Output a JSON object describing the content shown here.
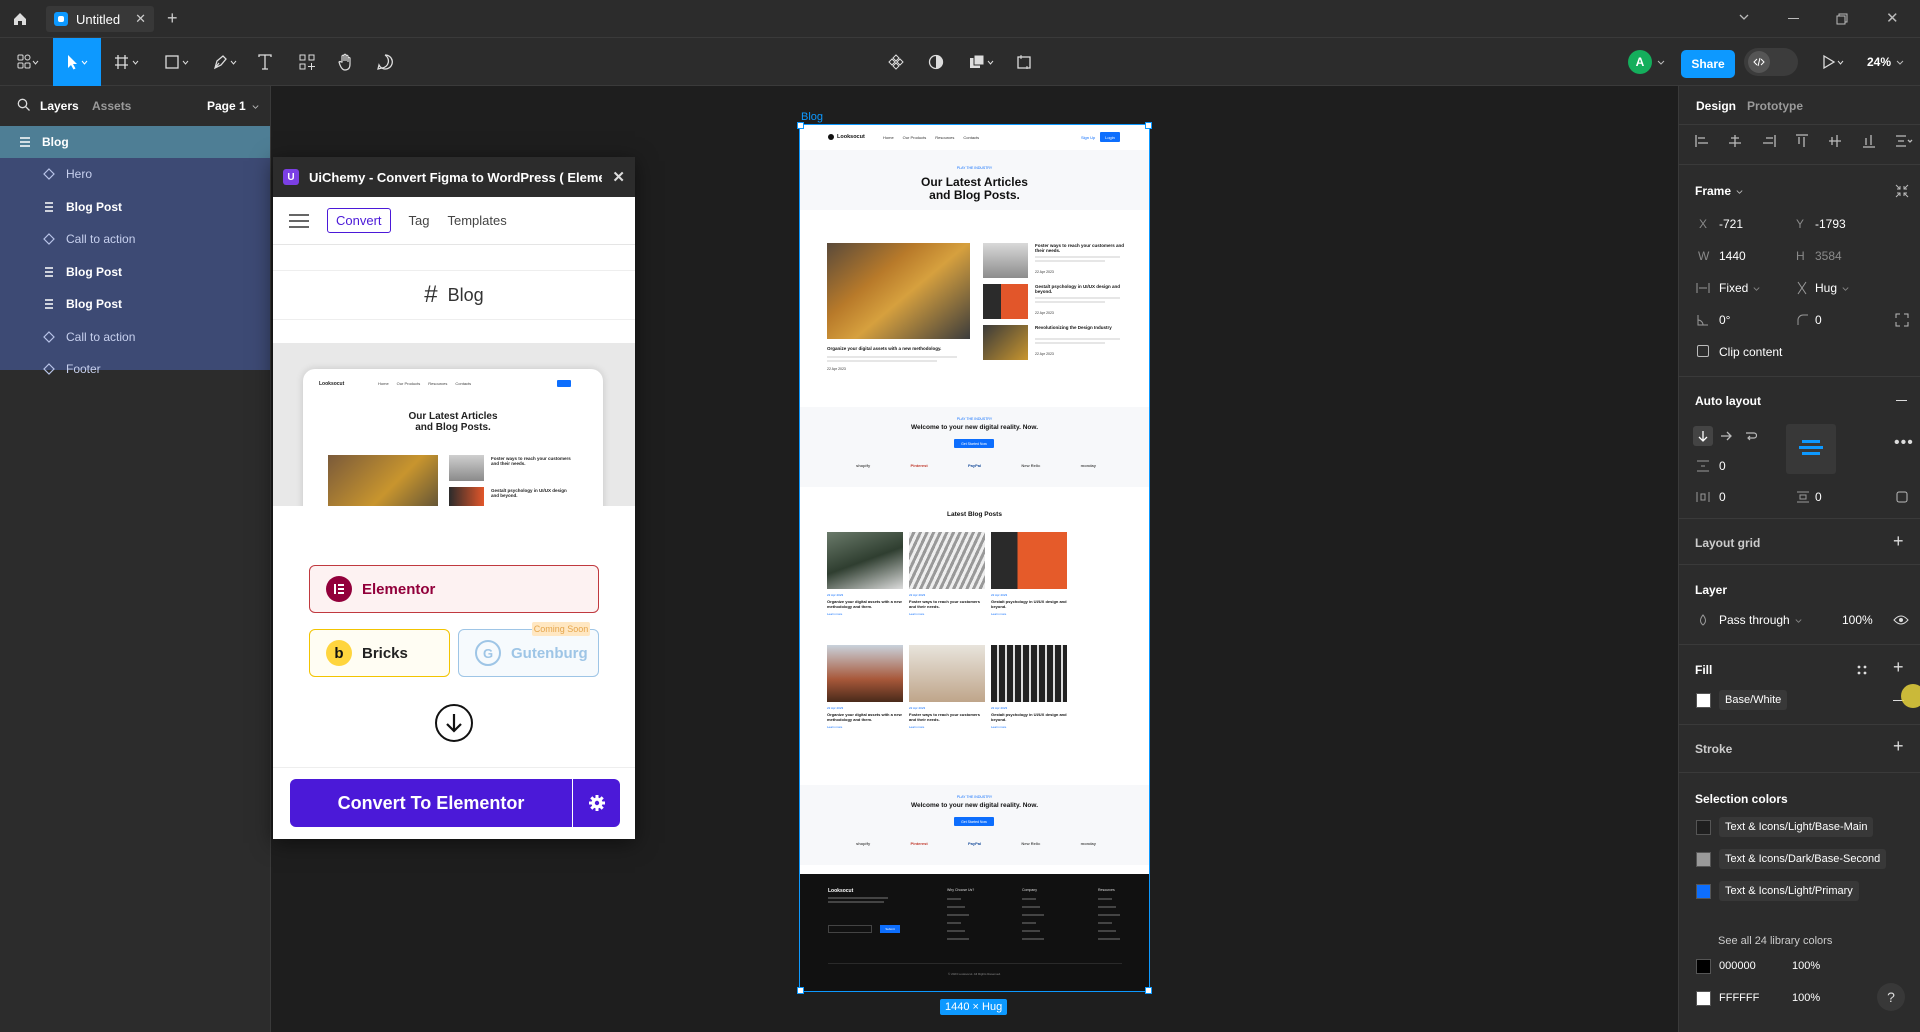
{
  "window": {
    "tab_title": "Untitled"
  },
  "toolbar": {
    "share_label": "Share",
    "zoom": "24%",
    "avatar_letter": "A"
  },
  "left_panel": {
    "tabs": [
      "Layers",
      "Assets"
    ],
    "page": "Page 1",
    "root_layer": "Blog",
    "layers": [
      {
        "name": "Hero",
        "kind": "component"
      },
      {
        "name": "Blog Post",
        "kind": "autolayout"
      },
      {
        "name": "Call to action",
        "kind": "component"
      },
      {
        "name": "Blog Post",
        "kind": "autolayout"
      },
      {
        "name": "Blog Post",
        "kind": "autolayout"
      },
      {
        "name": "Call to action",
        "kind": "component"
      },
      {
        "name": "Footer",
        "kind": "component"
      }
    ]
  },
  "plugin": {
    "title": "UiChemy - Convert Figma to WordPress ( Elemento...",
    "tabs": [
      "Convert",
      "Tag",
      "Templates"
    ],
    "frame_name": "Blog",
    "preview": {
      "logo": "Looksocut",
      "nav": [
        "Home",
        "Our Products",
        "Resources",
        "Contacts"
      ],
      "heading_l1": "Our Latest Articles",
      "heading_l2": "and Blog Posts.",
      "side1": "Foster ways to reach your customers and their needs.",
      "side2": "Gestalt psychology in UI/UX design and beyond."
    },
    "builders": {
      "elementor": "Elementor",
      "bricks": "Bricks",
      "gutenburg": "Gutenburg",
      "coming_soon": "Coming Soon"
    },
    "convert_label": "Convert To Elementor"
  },
  "canvas": {
    "frame_label": "Blog",
    "size_badge": "1440 × Hug",
    "site": {
      "logo": "Looksocut",
      "nav": [
        "Home",
        "Our Products",
        "Resources",
        "Contacts"
      ],
      "signin": "Sign Up",
      "login": "Login",
      "eyebrow": "PLAY THE INDUSTRY",
      "hero_l1": "Our Latest Articles",
      "hero_l2": "and Blog Posts.",
      "feature_title": "Organize your digital assets with a new methodology.",
      "feature_date": "22 Apr 2023",
      "side_posts": [
        {
          "title": "Foster ways to reach your customers and their needs.",
          "date": "22 Apr 2023"
        },
        {
          "title": "Gestalt psychology in UI/UX design and beyond.",
          "date": "22 Apr 2023"
        },
        {
          "title": "Revolutionizing the Design Industry",
          "date": "22 Apr 2023"
        }
      ],
      "cta_eyebrow": "PLAY THE INDUSTRY",
      "cta_title": "Welcome to your new digital reality. Now.",
      "cta_button": "Get Started Now",
      "logos": [
        "shopify",
        "Pinterest",
        "PayPal",
        "New Relic",
        "monday"
      ],
      "latest_title": "Latest Blog Posts",
      "grid_posts": [
        {
          "title": "Organize your digital assets with a new methodology and them.",
          "date": "22 Apr 2023",
          "more": "Learn more"
        },
        {
          "title": "Foster ways to reach your customers and their needs.",
          "date": "22 Apr 2023",
          "more": "Learn more"
        },
        {
          "title": "Gestalt psychology in UI/UX design and beyond.",
          "date": "22 Apr 2023",
          "more": "Learn more"
        },
        {
          "title": "Organize your digital assets with a new methodology and them.",
          "date": "22 Apr 2023",
          "more": "Learn more"
        },
        {
          "title": "Foster ways to reach your customers and their needs.",
          "date": "22 Apr 2023",
          "more": "Learn more"
        },
        {
          "title": "Gestalt psychology in UI/UX design and beyond.",
          "date": "22 Apr 2023",
          "more": "Learn more"
        }
      ],
      "footer_cols": [
        "Why Choose Us?",
        "Company",
        "Resources"
      ],
      "footer_submit": "Submit",
      "copyright": "© 2023 Looksocut. All Rights Reserved."
    }
  },
  "right_panel": {
    "tabs": [
      "Design",
      "Prototype"
    ],
    "frame_section": "Frame",
    "x_label": "X",
    "x": "-721",
    "y_label": "Y",
    "y": "-1793",
    "w_label": "W",
    "w": "1440",
    "h_label": "H",
    "h": "3584",
    "width_mode": "Fixed",
    "height_mode": "Hug",
    "rotation": "0°",
    "radius": "0",
    "clip_content": "Clip content",
    "auto_layout": "Auto layout",
    "gap": "0",
    "padding_h": "0",
    "padding_v": "0",
    "layout_grid": "Layout grid",
    "layer_section": "Layer",
    "blend": "Pass through",
    "opacity": "100%",
    "fill_section": "Fill",
    "fill_style": "Base/White",
    "stroke_section": "Stroke",
    "selection_colors": "Selection colors",
    "colors": [
      {
        "name": "Text & Icons/Light/Base-Main",
        "hex": "#1f1f1f"
      },
      {
        "name": "Text & Icons/Dark/Base-Second",
        "hex": "#9a9a9a"
      },
      {
        "name": "Text & Icons/Light/Primary",
        "hex": "#0d6efd"
      }
    ],
    "see_all": "See all 24 library colors",
    "raw_colors": [
      {
        "hex": "000000",
        "opacity": "100%",
        "swatch": "#000000"
      },
      {
        "hex": "FFFFFF",
        "opacity": "100%",
        "swatch": "#ffffff"
      }
    ],
    "help": "?"
  }
}
